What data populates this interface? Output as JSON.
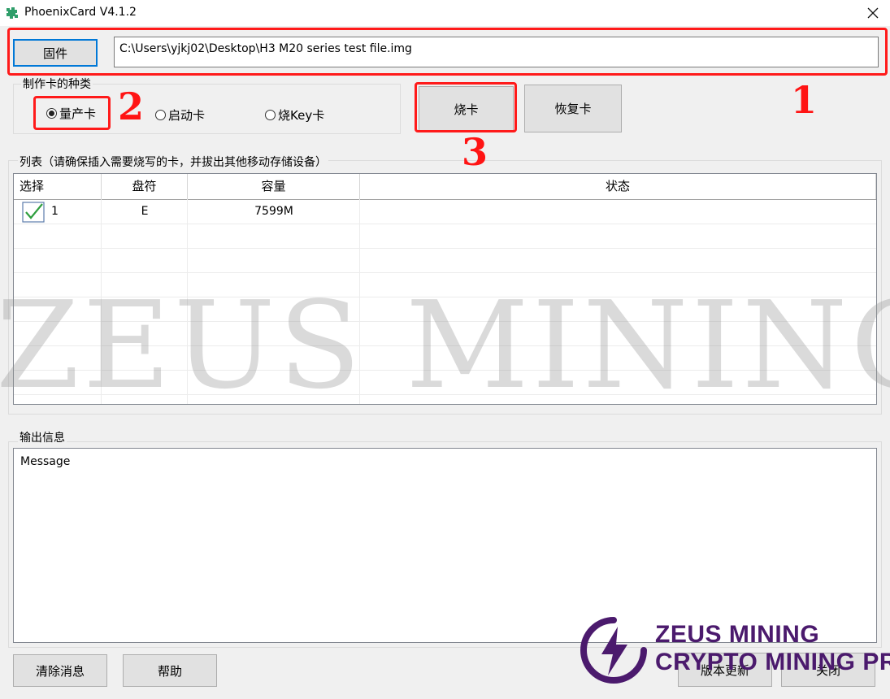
{
  "window": {
    "title": "PhoenixCard V4.1.2"
  },
  "firmware": {
    "button_label": "固件",
    "path_value": "C:\\Users\\yjkj02\\Desktop\\H3 M20 series test file.img"
  },
  "card_type": {
    "group_label": "制作卡的种类",
    "options": [
      {
        "label": "量产卡",
        "selected": true
      },
      {
        "label": "启动卡",
        "selected": false
      },
      {
        "label": "烧Key卡",
        "selected": false
      }
    ]
  },
  "actions": {
    "burn_label": "烧卡",
    "restore_label": "恢复卡"
  },
  "device_list": {
    "group_label": "列表（请确保插入需要烧写的卡，并拔出其他移动存储设备）",
    "columns": [
      "选择",
      "盘符",
      "容量",
      "状态"
    ],
    "rows": [
      {
        "index": "1",
        "checked": true,
        "drive": "E",
        "capacity": "7599M",
        "status": ""
      }
    ]
  },
  "output": {
    "group_label": "输出信息",
    "message": "Message"
  },
  "bottom_buttons": {
    "clear_label": "清除消息",
    "help_label": "帮助",
    "update_label": "版本更新",
    "close_label": "关闭"
  },
  "annotations": [
    "1",
    "2",
    "3"
  ],
  "watermark": {
    "text": "ZEUS MINING",
    "logo_line1": "ZEUS MINING",
    "logo_line2": "CRYPTO MINING PRO"
  },
  "colors": {
    "annotation_red": "#ff1a1a",
    "focus_blue": "#0078d7",
    "check_green": "#2e9e3e",
    "logo_purple": "#4b1a6d"
  }
}
